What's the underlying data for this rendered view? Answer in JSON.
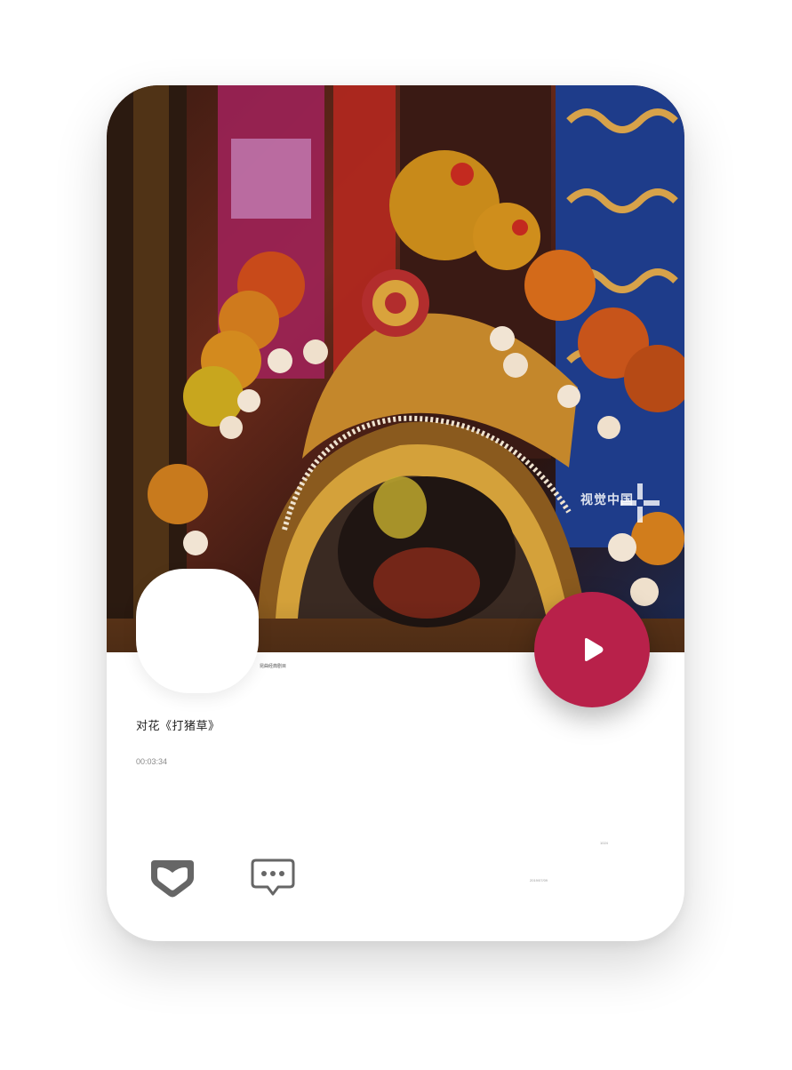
{
  "watermark": {
    "text": "视觉中国"
  },
  "media": {
    "caption": "昆曲经典剧目",
    "title": "对花《打猪草》",
    "duration": "00:03:34"
  },
  "stats": {
    "likes": "1024",
    "date": "2019/07/09"
  },
  "icons": {
    "play": "play-icon",
    "like": "heart-icon",
    "comment": "comment-icon"
  },
  "colors": {
    "accent": "#b8214a",
    "icon": "#666666"
  }
}
